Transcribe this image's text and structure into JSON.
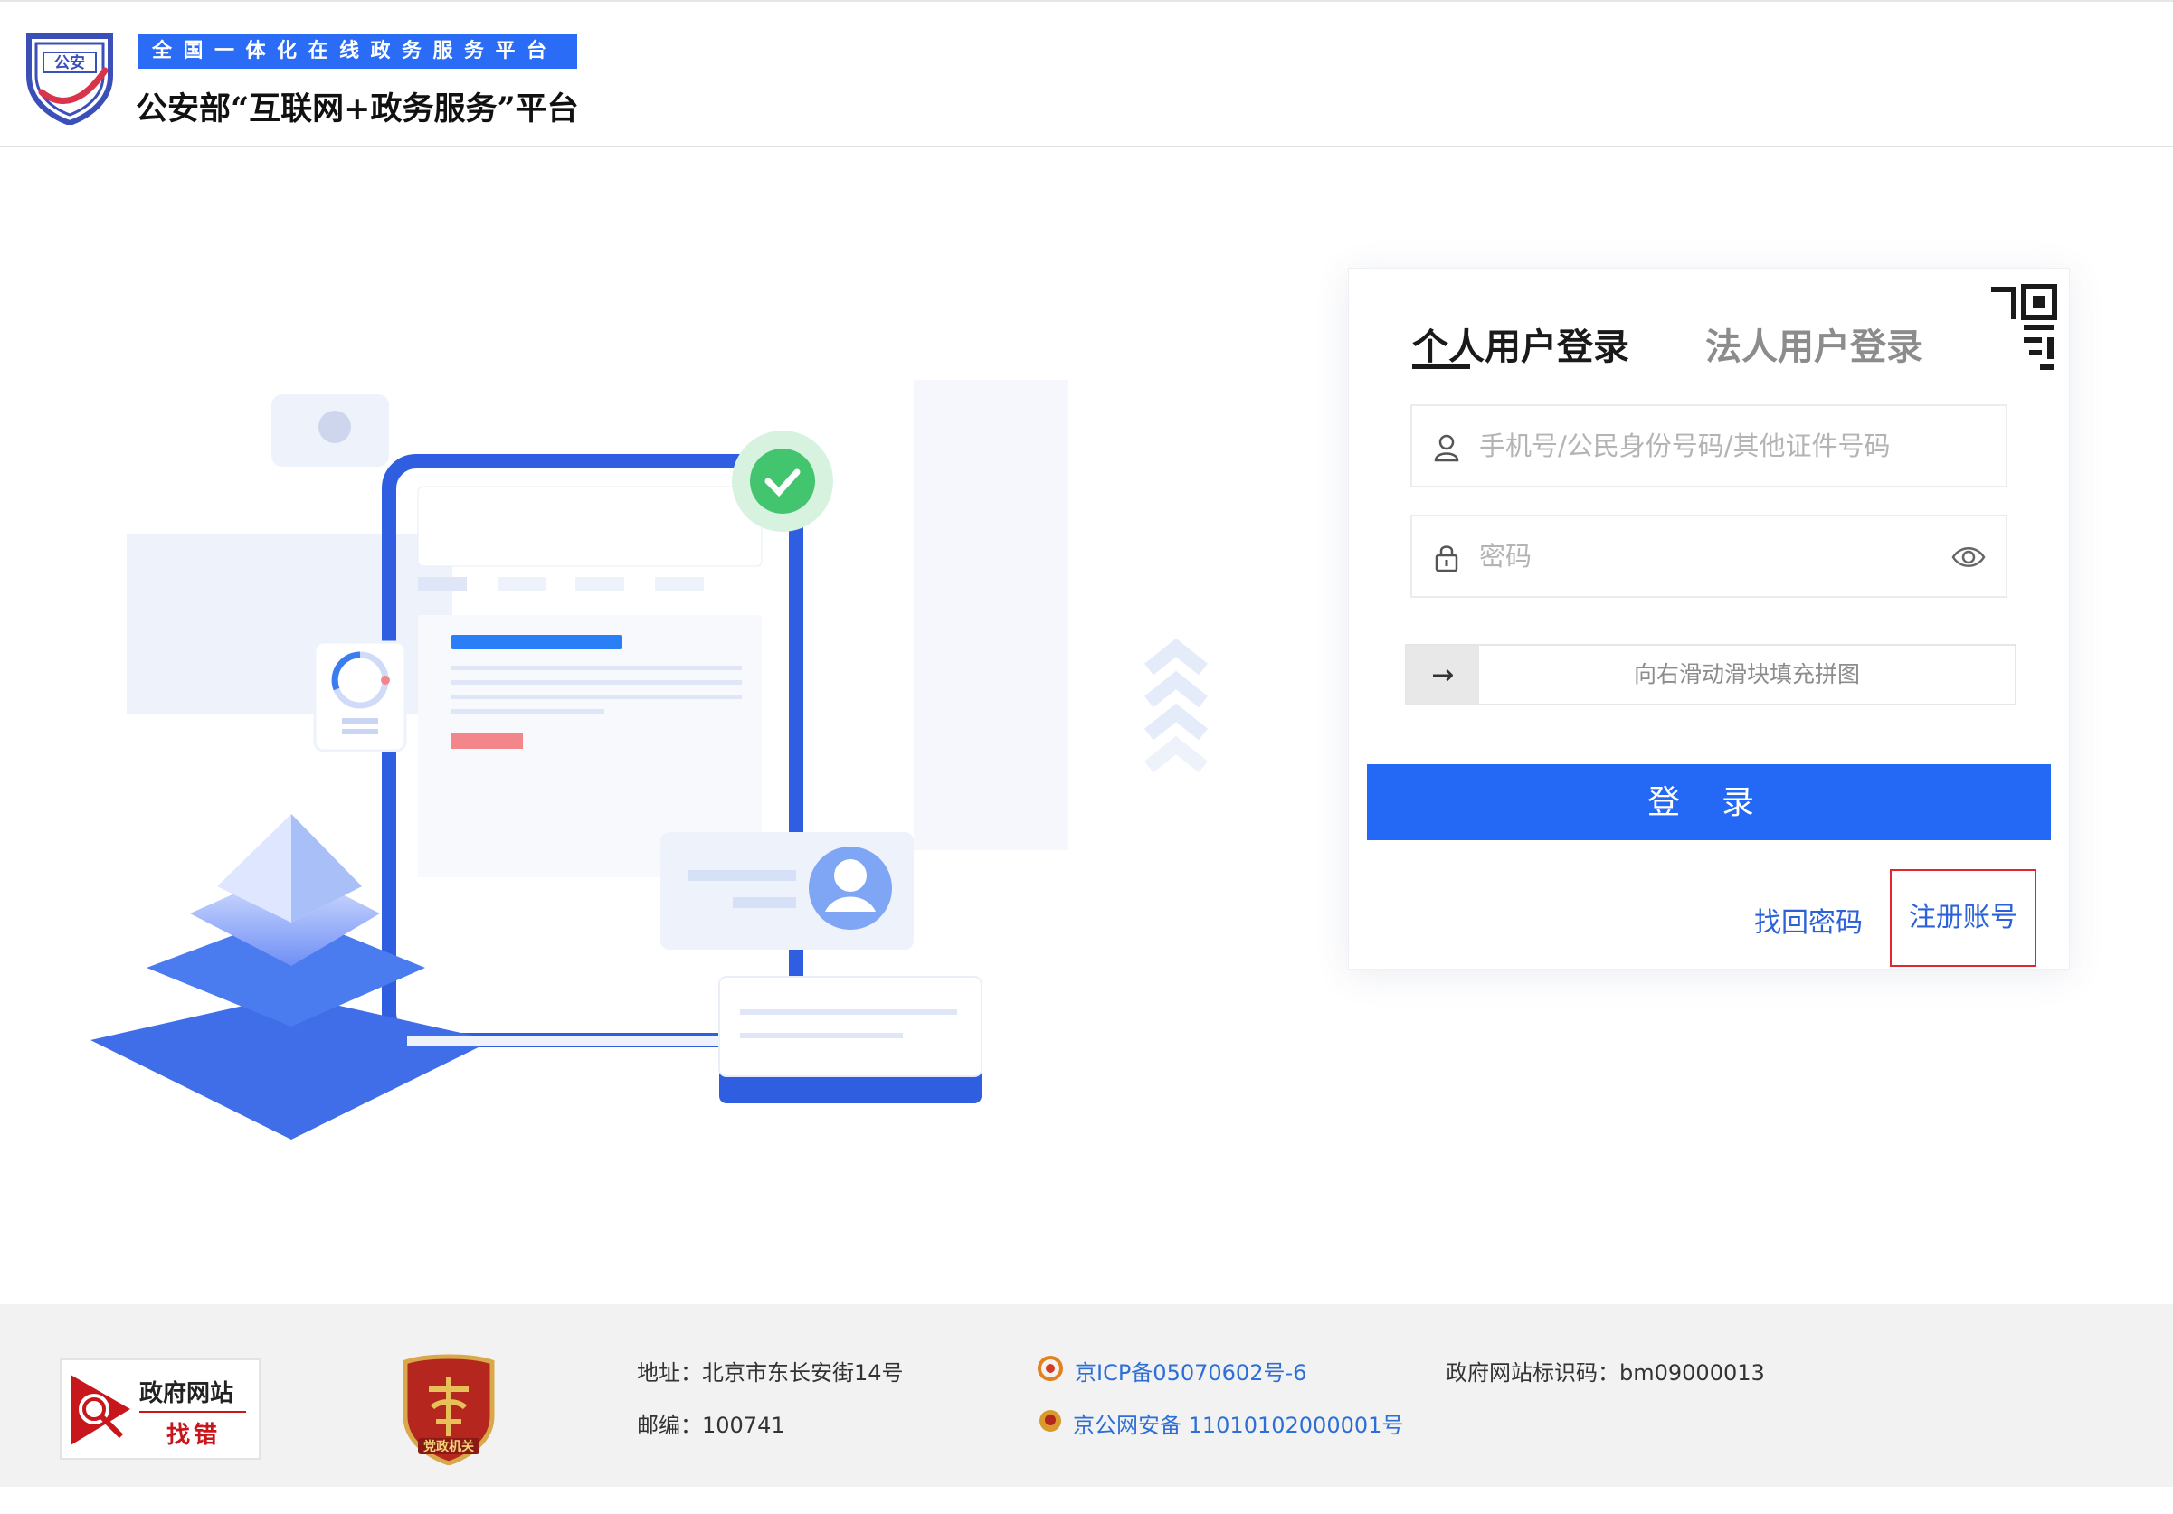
{
  "header": {
    "ribbon": "全国一体化在线政务服务平台",
    "title": "公安部“互联网+政务服务”平台",
    "logo_text": "公安"
  },
  "login": {
    "tab_personal": "个人用户登录",
    "tab_corporate": "法人用户登录",
    "username_placeholder": "手机号/公民身份号码/其他证件号码",
    "password_placeholder": "密码",
    "slider_arrow": "→",
    "slider_text": "向右滑动滑块填充拼图",
    "submit_label": "登 录",
    "forgot_label": "找回密码",
    "register_label": "注册账号"
  },
  "footer": {
    "find_error_line1": "政府网站",
    "find_error_line2": "找错",
    "party_badge_text": "党政机关",
    "address": "地址：北京市东长安街14号",
    "postcode": "邮编：100741",
    "icp": "京ICP备05070602号-6",
    "police_record": "京公网安备 11010102000001号",
    "site_code": "政府网站标识码：bm09000013"
  },
  "colors": {
    "primary": "#2469f5",
    "link": "#2b62d9",
    "highlight_border": "#e0262f",
    "footer_bg": "#f2f2f2"
  }
}
